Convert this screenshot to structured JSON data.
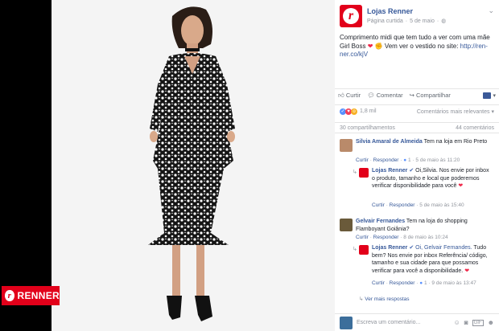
{
  "post": {
    "page_name": "Lojas Renner",
    "page_label": "Página curtida",
    "date": "5 de maio",
    "text": "Comprimento midi que tem tudo a ver com uma mãe Girl Boss",
    "text_tail": "Vem ver o vestido no site:",
    "link": "http://ren-ner.co/kjV"
  },
  "brand": {
    "logo_text": "RENNER"
  },
  "actions": {
    "like": "Curtir",
    "comment": "Comentar",
    "share": "Compartilhar"
  },
  "reactions": {
    "count": "1,8 mil",
    "sort": "Comentários mais relevantes"
  },
  "stats": {
    "shares": "30 compartilhamentos",
    "comments": "44 comentários"
  },
  "comments": [
    {
      "name": "Silvia Amaral de Almeida",
      "text": "Tem na loja em Rio Preto",
      "like": "Curtir",
      "reply": "Responder",
      "likes": "1",
      "time": "5 de maio às 11:20",
      "reply_item": {
        "name": "Lojas Renner",
        "text": "Oi,Silvia. Nos envie por inbox o produto, tamanho e local que poderemos verificar disponibilidade para você",
        "like": "Curtir",
        "reply": "Responder",
        "time": "5 de maio às 15:40"
      }
    },
    {
      "name": "Gelvair Fernandes",
      "text": "Tem na loja do shopping Flamboyant Goiânia?",
      "like": "Curtir",
      "reply": "Responder",
      "time": "8 de maio às 10:24",
      "reply_item": {
        "name": "Lojas Renner",
        "mention": "Oi, Gelvair Fernandes.",
        "text": "Tudo bem? Nos envie por inbox Referência/ código, tamanho e sua cidade para que possamos verificar para você a disponibilidade.",
        "like": "Curtir",
        "reply": "Responder",
        "likes": "1",
        "time": "9 de maio às 13:47"
      }
    }
  ],
  "more_replies": "Ver mais respostas",
  "composer": {
    "placeholder": "Escreva um comentário..."
  }
}
